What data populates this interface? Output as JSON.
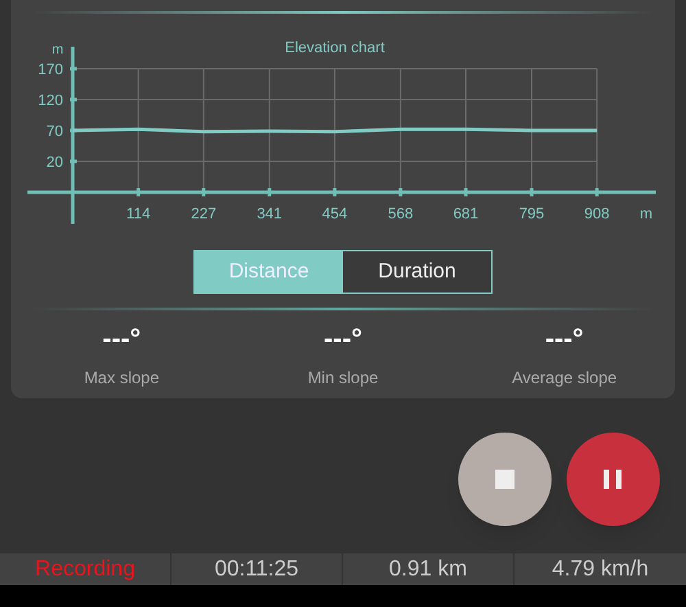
{
  "elevation_chart": {
    "chart_data": {
      "type": "line",
      "title": "Elevation chart",
      "xlabel": "m",
      "ylabel": "m",
      "x": [
        0,
        114,
        227,
        341,
        454,
        568,
        681,
        795,
        908
      ],
      "series": [
        {
          "color": "#80cbc4",
          "values": [
            70,
            72,
            68,
            69,
            68,
            72,
            72,
            70,
            70
          ]
        }
      ],
      "grid": true,
      "xlim": [
        -78,
        1010
      ],
      "ylim": [
        -30,
        170
      ],
      "xticks": [
        114,
        227,
        341,
        454,
        568,
        681,
        795,
        908
      ],
      "yticks": [
        20,
        70,
        120,
        170
      ]
    }
  },
  "mode_toggle": [
    {
      "label": "Distance",
      "selected": true
    },
    {
      "label": "Duration",
      "selected": false
    }
  ],
  "slopes": [
    {
      "value": "---°",
      "label": "Max slope"
    },
    {
      "value": "---°",
      "label": "Min slope"
    },
    {
      "value": "---°",
      "label": "Average slope"
    }
  ],
  "status_bar": {
    "state": "Recording",
    "time": "00:11:25",
    "distance": "0.91 km",
    "speed": "4.79 km/h"
  }
}
